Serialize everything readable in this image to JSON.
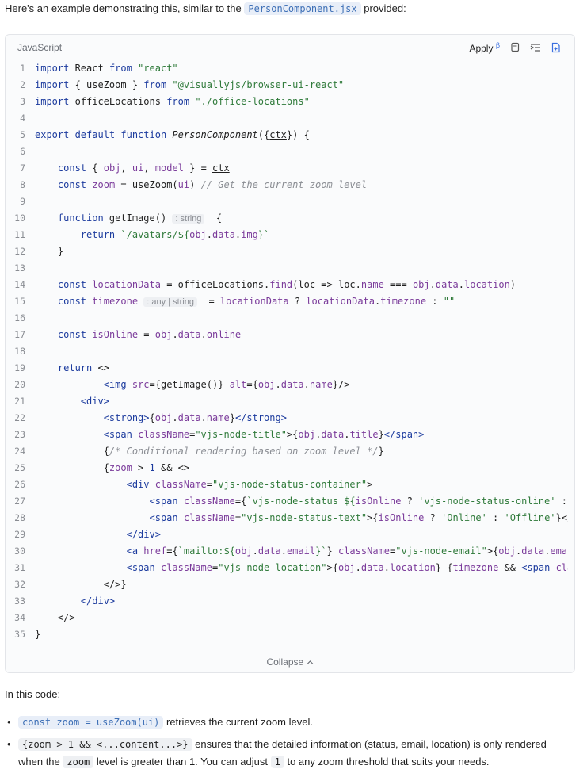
{
  "intro": {
    "before": "Here's an example demonstrating this, similar to the ",
    "file": "PersonComponent.jsx",
    "after": " provided:"
  },
  "code_block": {
    "language": "JavaScript",
    "apply_label": "Apply",
    "apply_sup": "β",
    "collapse_label": "Collapse",
    "lines": [
      {
        "n": "1",
        "html": "<span class=\"k\">import</span> React <span class=\"k\">from</span> <span class=\"s\">\"react\"</span>"
      },
      {
        "n": "2",
        "html": "<span class=\"k\">import</span> { useZoom } <span class=\"k\">from</span> <span class=\"s\">\"@visuallyjs/browser-ui-react\"</span>"
      },
      {
        "n": "3",
        "html": "<span class=\"k\">import</span> officeLocations <span class=\"k\">from</span> <span class=\"s\">\"./office-locations\"</span>"
      },
      {
        "n": "4",
        "html": ""
      },
      {
        "n": "5",
        "html": "<span class=\"k\">export default function</span> <span class=\"f\">PersonComponent</span>({<u>ctx</u>}) {"
      },
      {
        "n": "6",
        "html": ""
      },
      {
        "n": "7",
        "html": "    <span class=\"k\">const</span> { <span class=\"p\">obj</span>, <span class=\"p\">ui</span>, <span class=\"p\">model</span> } = <u>ctx</u>"
      },
      {
        "n": "8",
        "html": "    <span class=\"k\">const</span> <span class=\"p\">zoom</span> = useZoom(<span class=\"p\">ui</span>) <span class=\"c\">// Get the current zoom level</span>"
      },
      {
        "n": "9",
        "html": ""
      },
      {
        "n": "10",
        "html": "    <span class=\"k\">function</span> getImage() <span class=\"hint\">: string</span>  {"
      },
      {
        "n": "11",
        "html": "        <span class=\"k\">return</span> <span class=\"s\">`/avatars/${</span><span class=\"p\">obj</span>.<span class=\"p\">data</span>.<span class=\"p\">img</span><span class=\"s\">}`</span>"
      },
      {
        "n": "12",
        "html": "    }"
      },
      {
        "n": "13",
        "html": ""
      },
      {
        "n": "14",
        "html": "    <span class=\"k\">const</span> <span class=\"p\">locationData</span> = officeLocations.<span class=\"p\">find</span>(<u>loc</u> => <u>loc</u>.<span class=\"p\">name</span> === <span class=\"p\">obj</span>.<span class=\"p\">data</span>.<span class=\"p\">location</span>)"
      },
      {
        "n": "15",
        "html": "    <span class=\"k\">const</span> <span class=\"p\">timezone</span> <span class=\"hint\">: any | string</span>  = <span class=\"p\">locationData</span> ? <span class=\"p\">locationData</span>.<span class=\"p\">timezone</span> : <span class=\"s\">\"\"</span>"
      },
      {
        "n": "16",
        "html": ""
      },
      {
        "n": "17",
        "html": "    <span class=\"k\">const</span> <span class=\"p\">isOnline</span> = <span class=\"p\">obj</span>.<span class=\"p\">data</span>.<span class=\"p\">online</span>"
      },
      {
        "n": "18",
        "html": ""
      },
      {
        "n": "19",
        "html": "    <span class=\"k\">return</span> &lt;&gt;"
      },
      {
        "n": "20",
        "html": "            <span class=\"k\">&lt;img</span> <span class=\"p\">src</span>={getImage()} <span class=\"p\">alt</span>={<span class=\"p\">obj</span>.<span class=\"p\">data</span>.<span class=\"p\">name</span>}/&gt;"
      },
      {
        "n": "21",
        "html": "        <span class=\"k\">&lt;div&gt;</span>"
      },
      {
        "n": "22",
        "html": "            <span class=\"k\">&lt;strong&gt;</span>{<span class=\"p\">obj</span>.<span class=\"p\">data</span>.<span class=\"p\">name</span>}<span class=\"k\">&lt;/strong&gt;</span>"
      },
      {
        "n": "23",
        "html": "            <span class=\"k\">&lt;span</span> <span class=\"p\">className</span>=<span class=\"s\">\"vjs-node-title\"</span>&gt;{<span class=\"p\">obj</span>.<span class=\"p\">data</span>.<span class=\"p\">title</span>}<span class=\"k\">&lt;/span&gt;</span>"
      },
      {
        "n": "24",
        "html": "            {<span class=\"c\">/* Conditional rendering based on zoom level */</span>}"
      },
      {
        "n": "25",
        "html": "            {<span class=\"p\">zoom</span> &gt; <span class=\"k\">1</span> &amp;&amp; &lt;&gt;"
      },
      {
        "n": "26",
        "html": "                <span class=\"k\">&lt;div</span> <span class=\"p\">className</span>=<span class=\"s\">\"vjs-node-status-container\"</span>&gt;"
      },
      {
        "n": "27",
        "html": "                    <span class=\"k\">&lt;span</span> <span class=\"p\">className</span>={<span class=\"s\">`vjs-node-status ${</span><span class=\"p\">isOnline</span> ? <span class=\"s\">'vjs-node-status-online'</span> :"
      },
      {
        "n": "28",
        "html": "                    <span class=\"k\">&lt;span</span> <span class=\"p\">className</span>=<span class=\"s\">\"vjs-node-status-text\"</span>&gt;{<span class=\"p\">isOnline</span> ? <span class=\"s\">'Online'</span> : <span class=\"s\">'Offline'</span>}&lt;/"
      },
      {
        "n": "29",
        "html": "                <span class=\"k\">&lt;/div&gt;</span>"
      },
      {
        "n": "30",
        "html": "                <span class=\"k\">&lt;a</span> <span class=\"p\">href</span>={<span class=\"s\">`mailto:${</span><span class=\"p\">obj</span>.<span class=\"p\">data</span>.<span class=\"p\">email</span><span class=\"s\">}`</span>} <span class=\"p\">className</span>=<span class=\"s\">\"vjs-node-email\"</span>&gt;{<span class=\"p\">obj</span>.<span class=\"p\">data</span>.<span class=\"p\">emai</span>"
      },
      {
        "n": "31",
        "html": "                <span class=\"k\">&lt;span</span> <span class=\"p\">className</span>=<span class=\"s\">\"vjs-node-location\"</span>&gt;{<span class=\"p\">obj</span>.<span class=\"p\">data</span>.<span class=\"p\">location</span>} {<span class=\"p\">timezone</span> &amp;&amp; <span class=\"k\">&lt;span</span> <span class=\"p\">cla</span>"
      },
      {
        "n": "32",
        "html": "            &lt;/&gt;}"
      },
      {
        "n": "33",
        "html": "        <span class=\"k\">&lt;/div&gt;</span>"
      },
      {
        "n": "34",
        "html": "    &lt;/&gt;"
      },
      {
        "n": "35",
        "html": "}"
      }
    ]
  },
  "explanation": {
    "lead": "In this code:",
    "bullets": [
      {
        "code": "const zoom = useZoom(ui)",
        "text": " retrieves the current zoom level."
      },
      {
        "code": "{zoom > 1 && <...content...>}",
        "text_a": " ensures that the detailed information (status, email, location) is only rendered when the ",
        "code_b": "zoom",
        "text_b": " level is greater than 1. You can adjust ",
        "code_c": "1",
        "text_c": " to any zoom threshold that suits your needs."
      }
    ]
  }
}
